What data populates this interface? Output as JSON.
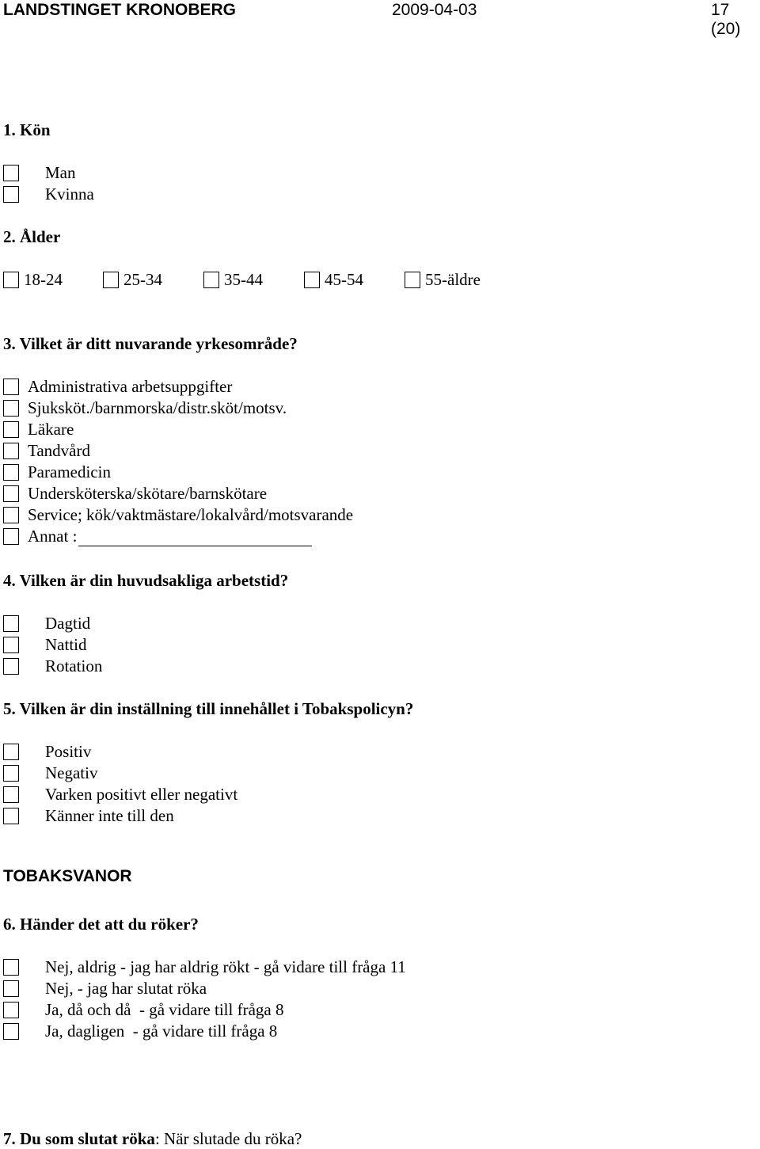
{
  "header": {
    "organization": "LANDSTINGET KRONOBERG",
    "date": "2009-04-03",
    "page": "17 (20)"
  },
  "questions": [
    {
      "title": "1. Kön",
      "options": [
        "Man",
        "Kvinna"
      ]
    },
    {
      "title": "2. Ålder",
      "options": [
        "18-24",
        "25-34",
        "35-44",
        "45-54",
        "55-äldre"
      ]
    },
    {
      "title": "3. Vilket är ditt nuvarande yrkesområde?",
      "options": [
        "Administrativa arbetsuppgifter",
        "Sjuksköt./barnmorska/distr.sköt/motsv.",
        "Läkare",
        "Tandvård",
        "Paramedicin",
        "Undersköterska/skötare/barnskötare",
        "Service; kök/vaktmästare/lokalvård/motsvarande",
        "Annat :"
      ],
      "other_value": ""
    },
    {
      "title": "4. Vilken är din huvudsakliga arbetstid?",
      "options": [
        "Dagtid",
        "Nattid",
        "Rotation"
      ]
    },
    {
      "title": "5. Vilken är din inställning till innehållet i Tobakspolicyn?",
      "options": [
        "Positiv",
        "Negativ",
        "Varken positivt eller negativt",
        "Känner inte till den"
      ]
    }
  ],
  "section_tobak": {
    "title": "TOBAKSVANOR",
    "q6": {
      "title": "6. Händer det att du röker?",
      "options": [
        "Nej, aldrig - jag har aldrig rökt - gå vidare till fråga 11",
        "Nej, - jag har slutat röka",
        "Ja, då och då  - gå vidare till fråga 8",
        "Ja, dagligen  - gå vidare till fråga 8"
      ]
    },
    "q7": {
      "title_bold": "7. Du som slutat röka",
      "title_rest": ": När slutade du röka?"
    }
  }
}
